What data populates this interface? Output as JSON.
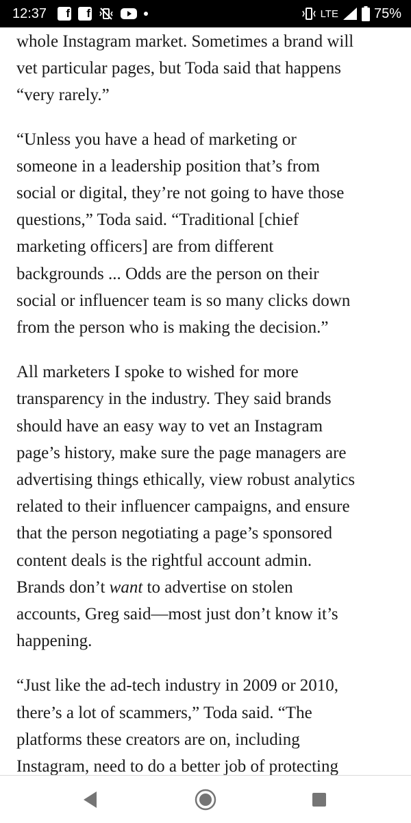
{
  "status_bar": {
    "time": "12:37",
    "network": "LTE",
    "battery": "75%",
    "notification_icons": [
      "facebook-icon",
      "facebook-icon",
      "vibrate-off-icon",
      "youtube-icon"
    ]
  },
  "article": {
    "p1": {
      "lines": [
        "whole Instagram market. Sometimes a brand will",
        "vet particular pages, but Toda said that happens",
        "“very rarely.”"
      ]
    },
    "p2": {
      "lines": [
        "“Unless you have a head of marketing or",
        "someone in a leadership position that’s from",
        "social or digital, they’re not going to have those",
        "questions,” Toda said. “Traditional [chief",
        "marketing officers] are from different",
        "backgrounds ... Odds are the person on their",
        "social or influencer team is so many clicks down",
        "from the person who is making the decision.”"
      ]
    },
    "p3": {
      "lines": [
        "All marketers I spoke to wished for more",
        "transparency in the industry. They said brands",
        "should have an easy way to vet an Instagram",
        "page’s history, make sure the page managers are",
        "advertising things ethically, view robust analytics",
        "related to their influencer campaigns, and ensure",
        "that the person negotiating a page’s sponsored",
        "content deals is the rightful account admin."
      ],
      "line9_before": "Brands don’t ",
      "line9_em": "want",
      "line9_after": " to advertise on stolen",
      "line10": "accounts, Greg said—most just don’t know it’s",
      "line11": "happening."
    },
    "p4": {
      "lines": [
        "“Just like the ad-tech industry in 2009 or 2010,",
        "there’s a lot of scammers,” Toda said. “The",
        "platforms these creators are on, including",
        "Instagram, need to do a better job of protecting"
      ]
    }
  },
  "nav_bar": {
    "buttons": [
      "back-icon",
      "home-icon",
      "recents-icon"
    ]
  },
  "colors": {
    "status_bar_bg": "#000000",
    "text": "#1a1a1a",
    "nav_icon": "#757575"
  }
}
